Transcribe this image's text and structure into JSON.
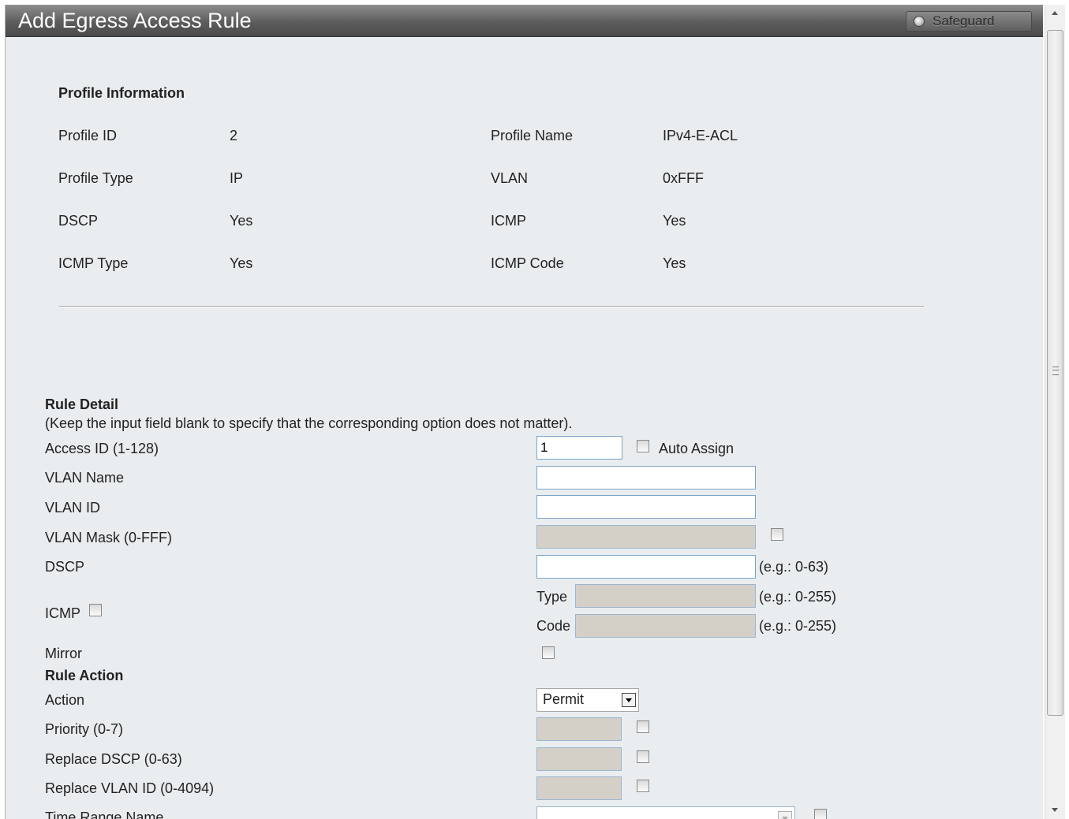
{
  "header": {
    "title": "Add Egress Access Rule",
    "safeguard_label": "Safeguard"
  },
  "profile": {
    "heading": "Profile Information",
    "rows": [
      {
        "label1": "Profile ID",
        "value1": "2",
        "label2": "Profile Name",
        "value2": "IPv4-E-ACL"
      },
      {
        "label1": "Profile Type",
        "value1": "IP",
        "label2": "VLAN",
        "value2": "0xFFF"
      },
      {
        "label1": "DSCP",
        "value1": "Yes",
        "label2": "ICMP",
        "value2": "Yes"
      },
      {
        "label1": "ICMP Type",
        "value1": "Yes",
        "label2": "ICMP Code",
        "value2": "Yes"
      }
    ]
  },
  "rule_detail": {
    "heading": "Rule Detail",
    "note": "(Keep the input field blank to specify that the corresponding option does not matter).",
    "access_id_label": "Access ID (1-128)",
    "access_id_value": "1",
    "auto_assign_label": "Auto Assign",
    "vlan_name_label": "VLAN Name",
    "vlan_id_label": "VLAN ID",
    "vlan_mask_label": "VLAN Mask (0-FFF)",
    "dscp_label": "DSCP",
    "dscp_hint": "(e.g.: 0-63)",
    "icmp_label": "ICMP",
    "icmp_type_label": "Type",
    "icmp_type_hint": "(e.g.: 0-255)",
    "icmp_code_label": "Code",
    "icmp_code_hint": "(e.g.: 0-255)",
    "mirror_label": "Mirror"
  },
  "rule_action": {
    "heading": "Rule Action",
    "action_label": "Action",
    "action_value": "Permit",
    "priority_label": "Priority  (0-7)",
    "replace_dscp_label": "Replace DSCP  (0-63)",
    "replace_vlan_label": "Replace VLAN ID  (0-4094)",
    "time_range_label": "Time Range Name"
  }
}
